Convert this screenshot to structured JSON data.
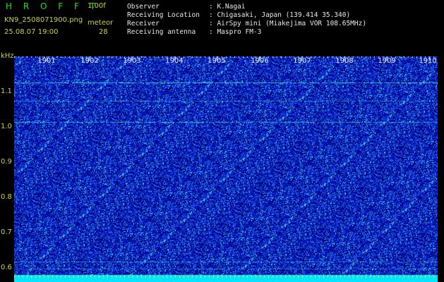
{
  "header": {
    "app_name": "H R O F F T",
    "version": "1.00f",
    "filename": "KN9_2508071900.png",
    "meteor_label": "meteor",
    "timestamp": "25.08.07 19:00",
    "count": "28"
  },
  "info": [
    {
      "key": "Observer",
      "value": ": K.Nagai"
    },
    {
      "key": "Receiving Location",
      "value": ": Chigasaki, Japan (139.414 35.340)"
    },
    {
      "key": "Receiver",
      "value": ": AirSpy mini (Miakejima VOR 108.65MHz)"
    },
    {
      "key": "Receiving antenna",
      "value": ": Maspro FM-3"
    }
  ],
  "axes": {
    "unit_label": "kHz",
    "y_ticks": [
      "1.1",
      "1.0",
      "0.9",
      "0.8",
      "0.7",
      "0.6"
    ],
    "x_ticks": [
      "1901",
      "1902",
      "1903",
      "1904",
      "1905",
      "1906",
      "1907",
      "1908",
      "1909",
      "1910"
    ]
  },
  "colors": {
    "background": "#000000",
    "noise_dark": "#0000a0",
    "noise_mid": "#1a3cff",
    "signal": "#22e0e0",
    "bottom_band": "#00e6ff",
    "label_yellow": "#d0d040"
  }
}
